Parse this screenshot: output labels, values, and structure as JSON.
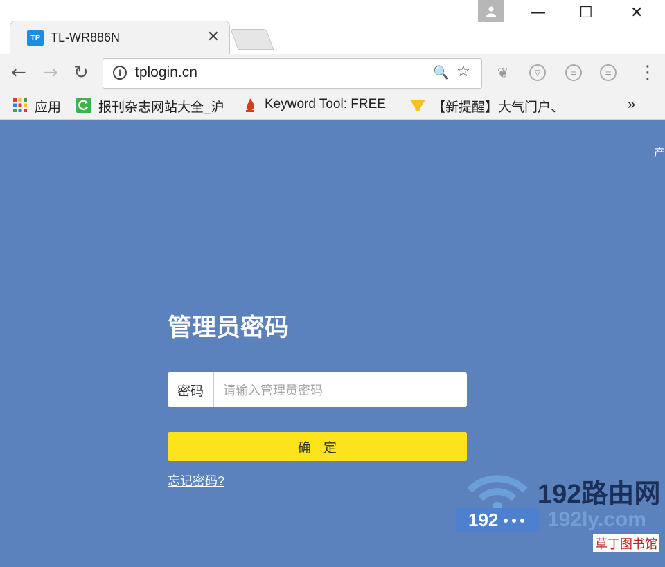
{
  "browser": {
    "tab": {
      "favicon_text": "TP",
      "title": "TL-WR886N",
      "close": "✕"
    },
    "window_controls": {
      "minimize": "—",
      "maximize": "☐",
      "close": "✕"
    },
    "toolbar": {
      "back": "←",
      "forward": "→",
      "reload": "↻",
      "url": "tplogin.cn",
      "info": "i",
      "zoom": "🔍",
      "star": "☆",
      "menu": "⋮"
    },
    "bookmarks": [
      {
        "label": "应用",
        "icon": "apps-grid-icon"
      },
      {
        "label": "报刊杂志网站大全_沪",
        "icon": "green-refresh-icon"
      },
      {
        "label": "Keyword Tool: FREE",
        "icon": "flame-icon"
      },
      {
        "label": "【新提醒】大气门户、",
        "icon": "bell-icon"
      }
    ],
    "bookmarks_overflow": "»"
  },
  "page": {
    "corner_text": "产",
    "login": {
      "title": "管理员密码",
      "password_label": "密码",
      "password_placeholder": "请输入管理员密码",
      "confirm_label": "确定",
      "forgot_link": "忘记密码?"
    },
    "watermark": {
      "router_number": "192",
      "brand": "192路由网",
      "site": "192ly.com",
      "tag": "草丁图书馆"
    }
  },
  "colors": {
    "page_bg": "#5b82bc",
    "confirm_bg": "#fde31c",
    "favicon_bg": "#1a8ee6"
  }
}
